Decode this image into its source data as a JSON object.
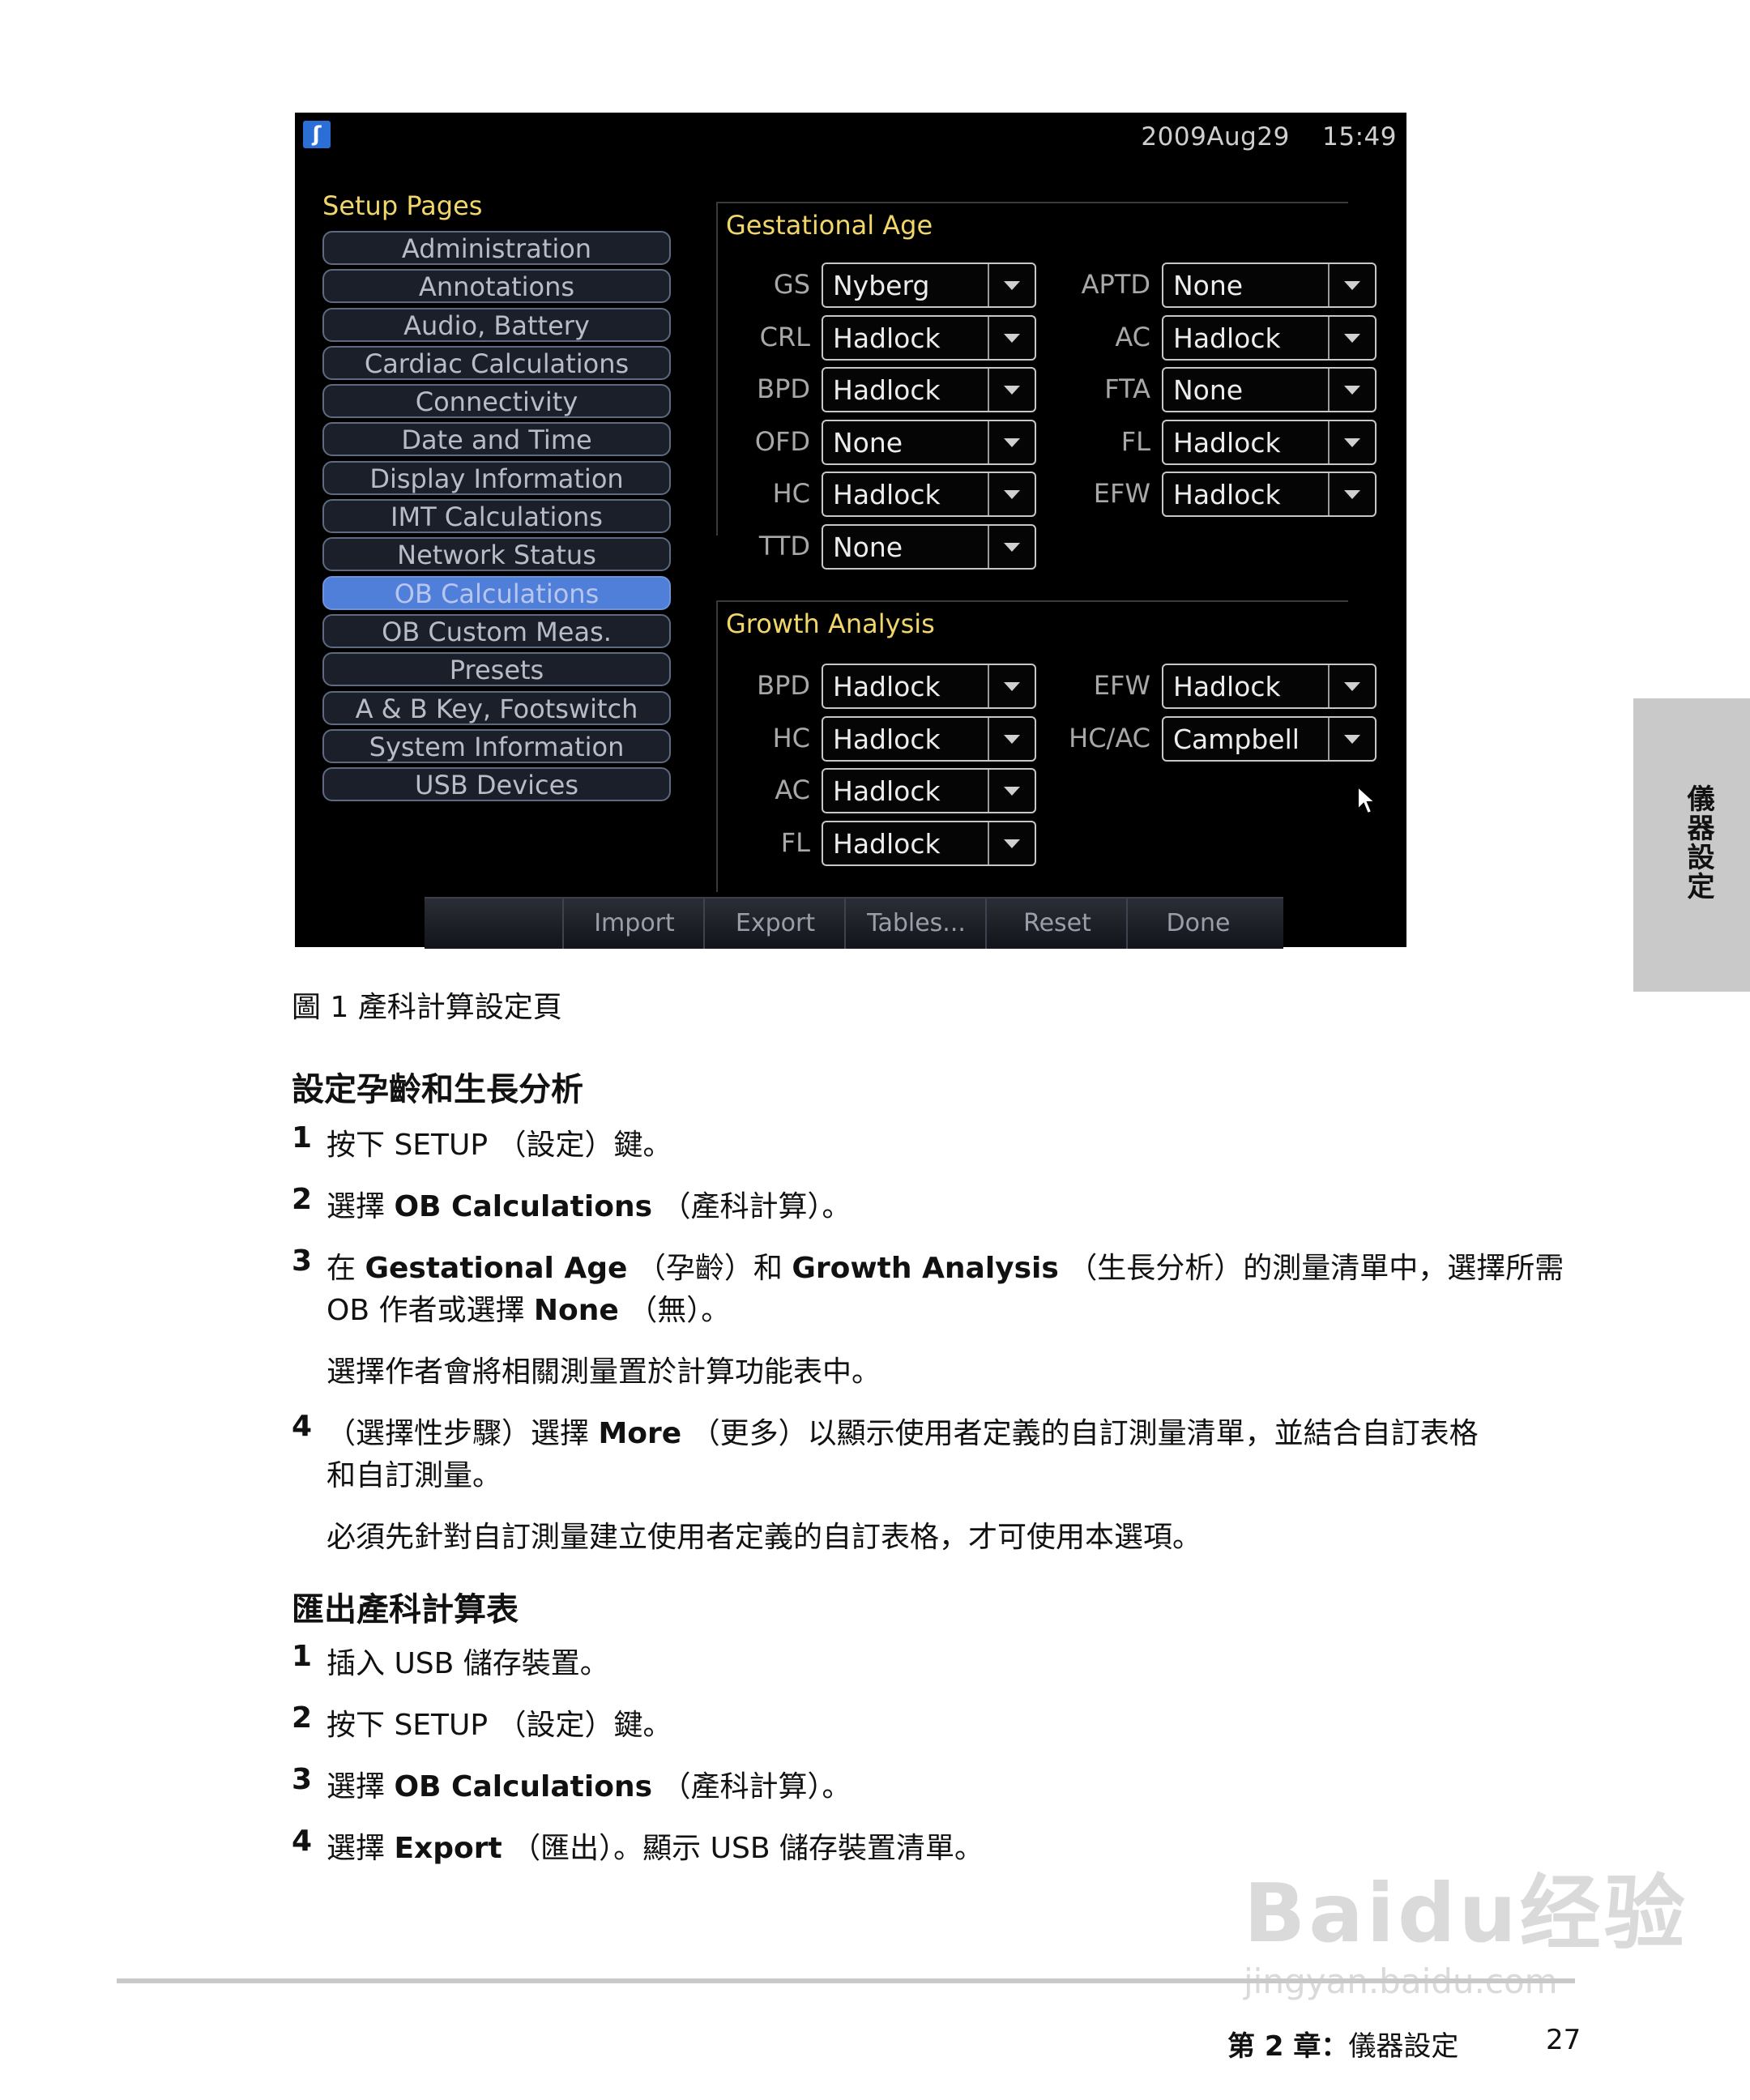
{
  "screen": {
    "date": "2009Aug29",
    "time": "15:49",
    "setup_title": "Setup Pages",
    "nav_items": [
      "Administration",
      "Annotations",
      "Audio, Battery",
      "Cardiac Calculations",
      "Connectivity",
      "Date and Time",
      "Display Information",
      "IMT Calculations",
      "Network Status",
      "OB Calculations",
      "OB Custom Meas.",
      "Presets",
      "A & B Key, Footswitch",
      "System Information",
      "USB Devices"
    ],
    "active_nav": "OB Calculations",
    "gestational_age": {
      "title": "Gestational Age",
      "left": [
        {
          "label": "GS",
          "value": "Nyberg"
        },
        {
          "label": "CRL",
          "value": "Hadlock"
        },
        {
          "label": "BPD",
          "value": "Hadlock"
        },
        {
          "label": "OFD",
          "value": "None"
        },
        {
          "label": "HC",
          "value": "Hadlock"
        },
        {
          "label": "TTD",
          "value": "None"
        }
      ],
      "right": [
        {
          "label": "APTD",
          "value": "None"
        },
        {
          "label": "AC",
          "value": "Hadlock"
        },
        {
          "label": "FTA",
          "value": "None"
        },
        {
          "label": "FL",
          "value": "Hadlock"
        },
        {
          "label": "EFW",
          "value": "Hadlock"
        }
      ]
    },
    "growth_analysis": {
      "title": "Growth Analysis",
      "left": [
        {
          "label": "BPD",
          "value": "Hadlock"
        },
        {
          "label": "HC",
          "value": "Hadlock"
        },
        {
          "label": "AC",
          "value": "Hadlock"
        },
        {
          "label": "FL",
          "value": "Hadlock"
        }
      ],
      "right": [
        {
          "label": "EFW",
          "value": "Hadlock"
        },
        {
          "label": "HC/AC",
          "value": "Campbell"
        }
      ]
    },
    "bottom_buttons": [
      "Import",
      "Export",
      "Tables...",
      "Reset",
      "Done"
    ]
  },
  "caption": "圖 1 產科計算設定頁",
  "section1": {
    "heading": "設定孕齡和生長分析",
    "steps": [
      {
        "n": "1",
        "html": "按下 SETUP （設定）鍵。"
      },
      {
        "n": "2",
        "html": "選擇 <b>OB Calculations</b> （產科計算）。"
      },
      {
        "n": "3",
        "html": "在 <b>Gestational Age</b> （孕齡）和 <b>Growth Analysis</b> （生長分析）的測量清單中，選擇所需"
      },
      {
        "n": "",
        "html": "OB 作者或選擇 <b>None</b> （無）。"
      },
      {
        "n": "",
        "html": "選擇作者會將相關測量置於計算功能表中。"
      },
      {
        "n": "4",
        "html": "（選擇性步驟）選擇 <b>More</b> （更多）以顯示使用者定義的自訂測量清單，並結合自訂表格"
      },
      {
        "n": "",
        "html": "和自訂測量。"
      },
      {
        "n": "",
        "html": "必須先針對自訂測量建立使用者定義的自訂表格，才可使用本選項。"
      }
    ]
  },
  "section2": {
    "heading": "匯出產科計算表",
    "steps": [
      {
        "n": "1",
        "html": "插入 USB 儲存裝置。"
      },
      {
        "n": "2",
        "html": "按下 SETUP （設定）鍵。"
      },
      {
        "n": "3",
        "html": "選擇 <b>OB Calculations</b> （產科計算）。"
      },
      {
        "n": "4",
        "html": "選擇 <b>Export</b> （匯出）。顯示 USB 儲存裝置清單。"
      }
    ]
  },
  "side_tab": "儀器設定",
  "footer": {
    "chapter": "第 2 章：儀器設定",
    "page": "27"
  },
  "watermark": {
    "big": "Baidu经验",
    "small": "jingyan.baidu.com"
  }
}
